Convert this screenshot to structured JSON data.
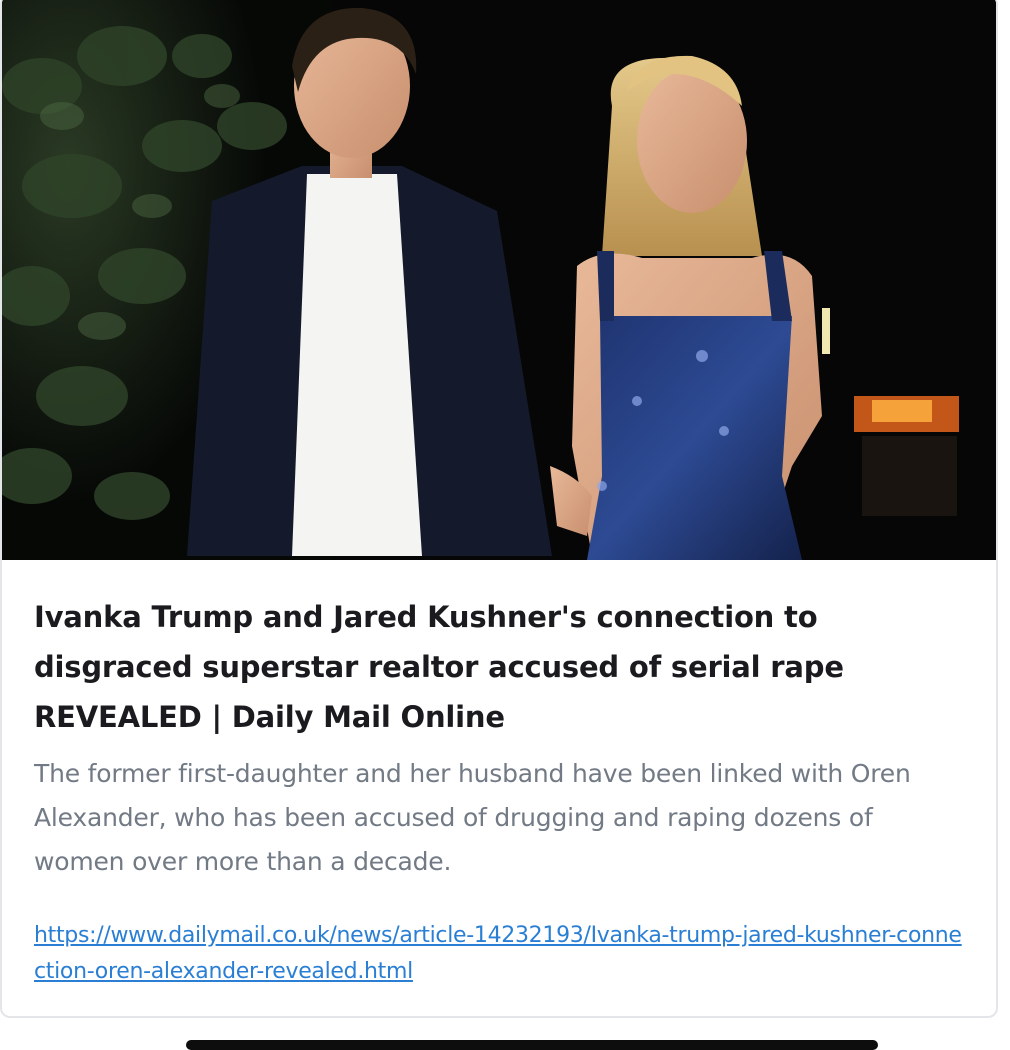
{
  "link_preview": {
    "image": {
      "description_icon": "photo-couple-walking-night"
    },
    "title": "Ivanka Trump and Jared Kushner's connection to disgraced superstar realtor accused of serial rape REVEALED | Daily Mail Online",
    "description": "The former first-daughter and her husband have been linked with Oren Alexander, who has been accused of drugging and raping dozens of women over more than a decade.",
    "url": "https://www.dailymail.co.uk/news/article-14232193/Ivanka-trump-jared-kushner-connection-oren-alexander-revealed.html"
  },
  "colors": {
    "title": "#1b1b1f",
    "description": "#727a85",
    "link": "#2a7fd4",
    "card_border": "#e3e5e8"
  }
}
